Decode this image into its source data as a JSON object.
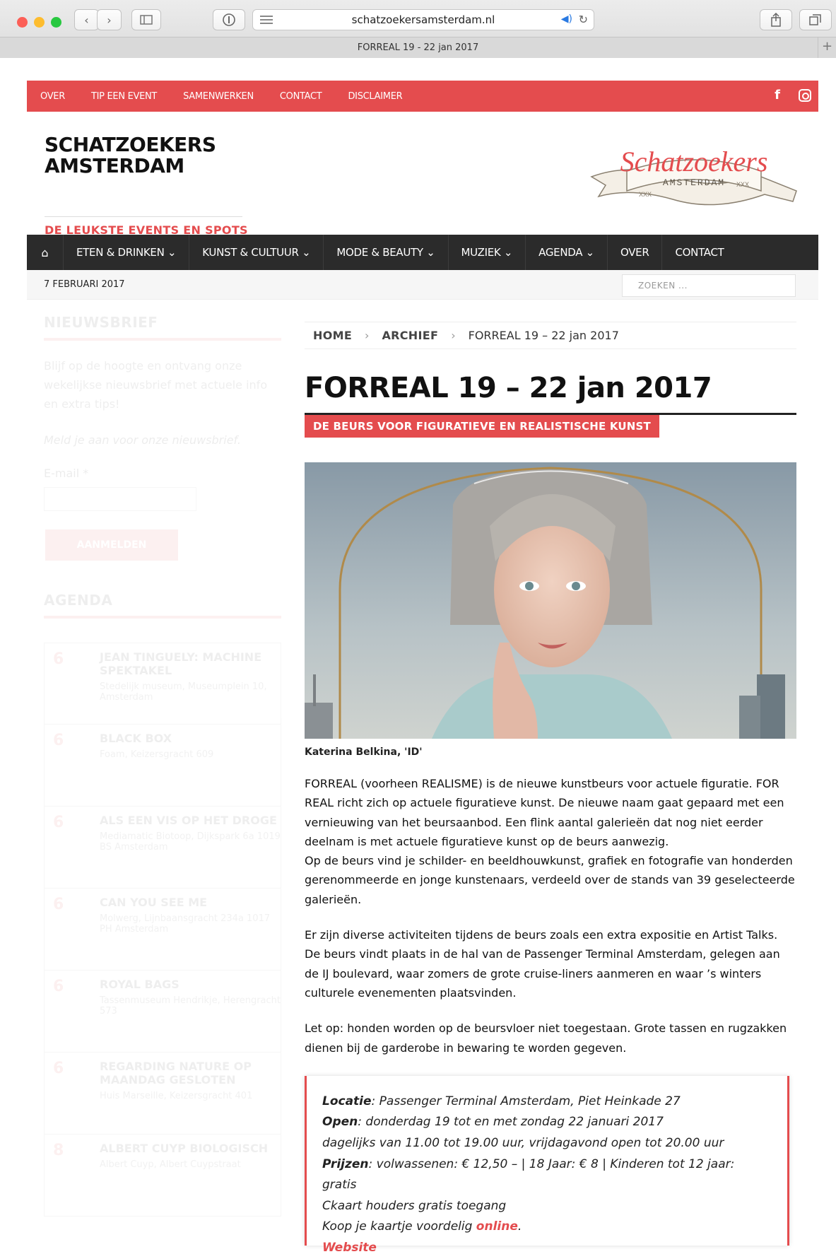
{
  "browser": {
    "url": "schatzoekersamsterdam.nl",
    "tab_title": "FORREAL 19 - 22 jan 2017",
    "tab_plus": "+",
    "back": "‹",
    "forward": "›"
  },
  "topnav": {
    "items": [
      "OVER",
      "TIP EEN EVENT",
      "SAMENWERKEN",
      "CONTACT",
      "DISCLAIMER"
    ],
    "facebook": "f"
  },
  "header": {
    "brand_line1": "SCHATZOEKERS",
    "brand_line2": "AMSTERDAM",
    "tagline": "DE LEUKSTE EVENTS EN SPOTS",
    "logo_script": "Schatzoekers",
    "logo_banner": "AMSTERDAM",
    "logo_x": "XXX"
  },
  "mainnav": {
    "home_icon": "⌂",
    "items": [
      "ETEN & DRINKEN ⌄",
      "KUNST & CULTUUR ⌄",
      "MODE & BEAUTY ⌄",
      "MUZIEK ⌄",
      "AGENDA ⌄",
      "OVER",
      "CONTACT"
    ]
  },
  "datebar": {
    "date": "7 FEBRUARI 2017",
    "search_placeholder": "ZOEKEN ..."
  },
  "sidebar": {
    "newsletter_title": "NIEUWSBRIEF",
    "newsletter_text": "Blijf op de hoogte en ontvang onze wekelijkse nieuwsbrief met actuele info en extra tips!",
    "newsletter_em": "Meld je aan voor onze nieuwsbrief.",
    "email_label": "E-mail *",
    "submit": "AANMELDEN",
    "agenda_title": "AGENDA",
    "events": [
      {
        "day": "6",
        "title": "JEAN TINGUELY: MACHINE SPEKTAKEL",
        "sub": "Stedelijk museum, Museumplein 10, Amsterdam"
      },
      {
        "day": "6",
        "title": "BLACK BOX",
        "sub": "Foam, Keizersgracht 609"
      },
      {
        "day": "6",
        "title": "ALS EEN VIS OP HET DROGE",
        "sub": "Mediamatic Biotoop, Dijkspark 6a 1019 BS Amsterdam"
      },
      {
        "day": "6",
        "title": "CAN YOU SEE ME",
        "sub": "Molwerg, Lijnbaansgracht 234a 1017 PH Amsterdam"
      },
      {
        "day": "6",
        "title": "ROYAL BAGS",
        "sub": "Tassenmuseum Hendrikje, Herengracht 573"
      },
      {
        "day": "6",
        "title": "REGARDING NATURE OP MAANDAG GESLOTEN",
        "sub": "Huis Marseille, Keizersgracht 401"
      },
      {
        "day": "8",
        "title": "ALBERT CUYP BIOLOGISCH",
        "sub": "Albert Cuyp, Albert Cuypstraat"
      }
    ]
  },
  "article": {
    "breadcrumb": {
      "home": "HOME",
      "archive": "ARCHIEF",
      "current": "FORREAL 19 – 22 jan 2017",
      "sep": "›"
    },
    "title": "FORREAL 19 – 22 jan 2017",
    "subtitle": "DE BEURS VOOR FIGURATIEVE EN REALISTISCHE KUNST",
    "caption": "Katerina Belkina, 'ID'",
    "p1": "FORREAL (voorheen REALISME) is de nieuwe kunstbeurs voor actuele figuratie. FOR REAL richt zich op actuele figuratieve kunst. De nieuwe naam gaat gepaard met een vernieuwing van het beursaanbod. Een flink aantal galerieën dat nog niet eerder deelnam is met actuele figuratieve kunst op de beurs aanwezig.",
    "p1b": "Op de beurs vind je schilder- en beeldhouwkunst, grafiek en fotografie van honderden gerenommeerde en jonge kunstenaars, verdeeld over de stands van 39 geselecteerde galerieën.",
    "p2": "Er zijn diverse activiteiten tijdens de beurs zoals een extra expositie en Artist Talks. De beurs vindt plaats in de hal van de Passenger Terminal Amsterdam, gelegen aan de IJ boulevard, waar zomers de grote cruise-liners aanmeren en waar ’s winters culturele evenementen plaatsvinden.",
    "p3": "Let op: honden worden op de beursvloer niet toegestaan. Grote tassen en rugzakken dienen bij de garderobe in bewaring te worden gegeven.",
    "info": {
      "loc_label": "Locatie",
      "loc": ": Passenger Terminal Amsterdam, Piet Heinkade 27",
      "open_label": "Open",
      "open": ": donderdag 19 tot en met zondag 22 januari 2017",
      "hours": "dagelijks van 11.00 tot 19.00 uur, vrijdagavond open tot 20.00 uur",
      "price_label": "Prijzen",
      "price": ": volwassenen: € 12,50 – | 18 Jaar: € 8 | Kinderen tot 12 jaar: gratis",
      "ckaart": "Ckaart houders gratis toegang",
      "buy_pre": "Koop je kaartje voordelig ",
      "buy_link": "online",
      "buy_post": ".",
      "website": "Website"
    }
  },
  "colors": {
    "accent": "#e44c4e",
    "nav_dark": "#2b2b2b"
  }
}
